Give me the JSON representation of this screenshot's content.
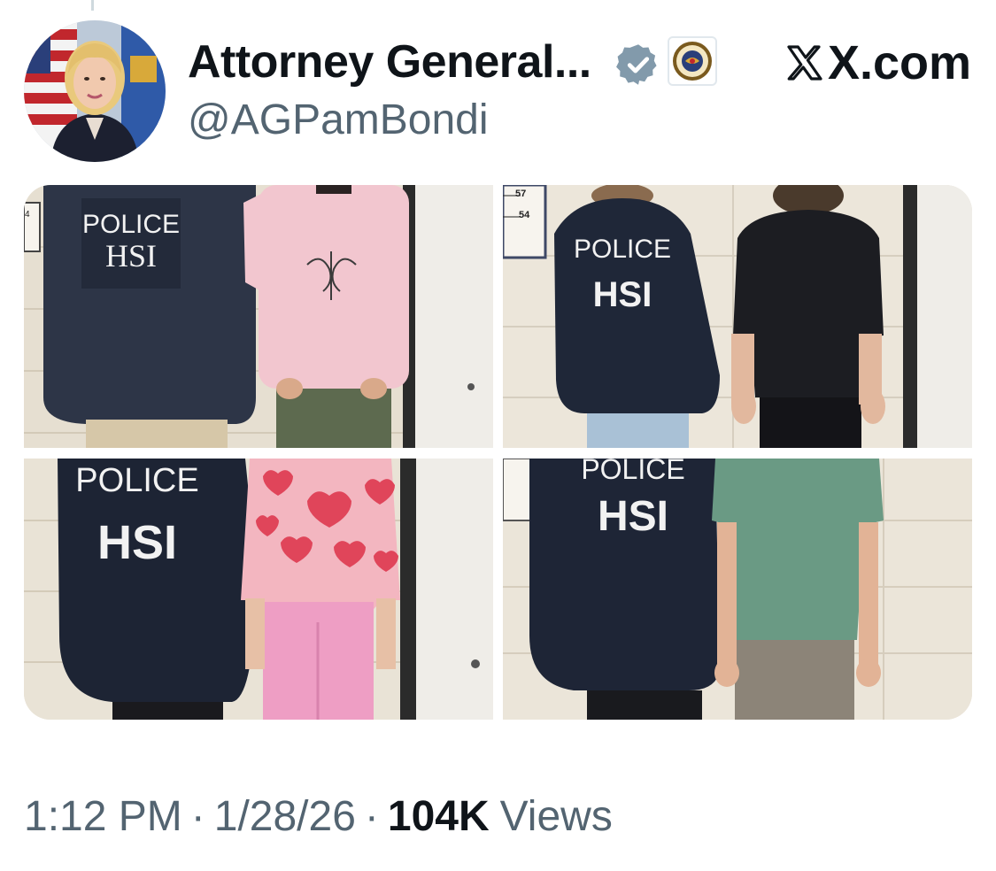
{
  "post": {
    "display_name": "Attorney General...",
    "handle": "@AGPamBondi",
    "site": "X.com",
    "verified": true,
    "affiliation_icon": "doj-seal-icon",
    "time": "1:12 PM",
    "separator": "·",
    "date": "1/28/26",
    "views_count": "104K",
    "views_label": "Views"
  },
  "media": [
    {
      "vest_line1": "POLICE",
      "vest_line2": "HSI",
      "ruler_mark": "4"
    },
    {
      "vest_line1": "POLICE",
      "vest_line2": "HSI",
      "ruler_mark_top": "57",
      "ruler_mark_bottom": "54"
    },
    {
      "vest_line1": "POLICE",
      "vest_line2": "HSI"
    },
    {
      "vest_line1": "POLICE",
      "vest_line2": "HSI"
    }
  ],
  "colors": {
    "text_primary": "#0f1419",
    "text_secondary": "#536471",
    "verified_badge": "#829aab",
    "vest_navy": "#1e2535",
    "wall": "#e9e3d6"
  }
}
